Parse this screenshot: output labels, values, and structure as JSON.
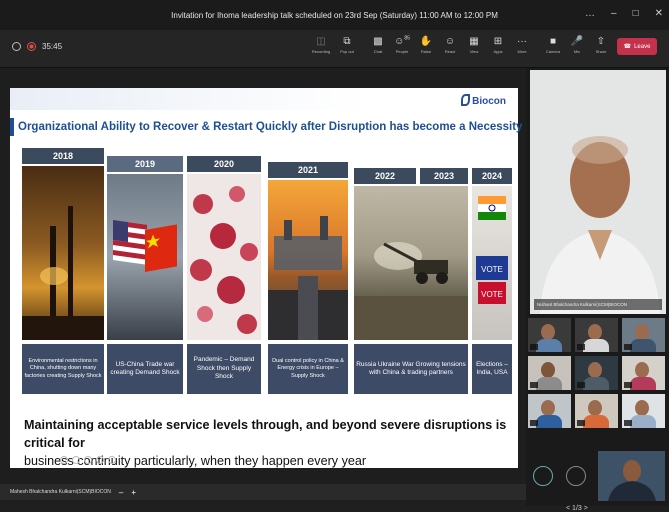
{
  "window": {
    "title": "Invitation for Ihoma leadership talk scheduled on 23rd Sep (Saturday) 11:00 AM to 12:00 PM",
    "controls": [
      "…",
      "–",
      "□",
      "✕"
    ]
  },
  "toolbar": {
    "timer": "35:45",
    "buttons": [
      {
        "label": "Recording",
        "icon": "record-icon",
        "dim": true
      },
      {
        "label": "Pop out",
        "icon": "pop-out-icon"
      },
      {
        "label": "Chat",
        "icon": "chat-icon"
      },
      {
        "label": "People",
        "icon": "people-icon",
        "badge": "85"
      },
      {
        "label": "Raise",
        "icon": "hand-icon"
      },
      {
        "label": "React",
        "icon": "smiley-icon"
      },
      {
        "label": "View",
        "icon": "view-icon"
      },
      {
        "label": "Apps",
        "icon": "apps-icon"
      },
      {
        "label": "More",
        "icon": "more-icon"
      },
      {
        "label": "Camera",
        "icon": "camera-icon"
      },
      {
        "label": "Mic",
        "icon": "mic-icon"
      },
      {
        "label": "Share",
        "icon": "share-icon"
      }
    ],
    "leave_label": "Leave"
  },
  "slide": {
    "brand": "Biocon",
    "title": "Organizational Ability to Recover & Restart Quickly after Disruption has become a Necessity",
    "columns": [
      {
        "year": "2018",
        "caption": "Environmental restrictions in China, shutting down many factories creating Supply Shock"
      },
      {
        "year": "2019",
        "caption": "US-China Trade war creating Demand Shock"
      },
      {
        "year": "2020",
        "caption": "Pandemic – Demand Shock then Supply Shock"
      },
      {
        "year": "2021",
        "caption": "Dual control policy in China & Energy crisis in Europe – Supply Shock"
      },
      {
        "year": "2022",
        "caption": "Russia Ukraine War Growing tensions with China & trading partners"
      },
      {
        "year": "2023",
        "caption": ""
      },
      {
        "year": "2024",
        "caption": "Elections – India, USA"
      }
    ],
    "body_line1": "Maintaining acceptable service levels through, and beyond severe disruptions is critical for",
    "body_line2": "business continuity particularly, when they happen every year"
  },
  "presenter": {
    "name": "Mahesh Bhalchandra Kulkarni(SCM)BIOCON"
  },
  "video": {
    "main_name": "Nishant Bhalchandra Kulkarni(SCM)BIOCON",
    "pager": "1/3"
  },
  "colors": {
    "title_blue": "#1f4e95",
    "caption_bg": "#3d4b66",
    "leave_red": "#c4314b"
  }
}
